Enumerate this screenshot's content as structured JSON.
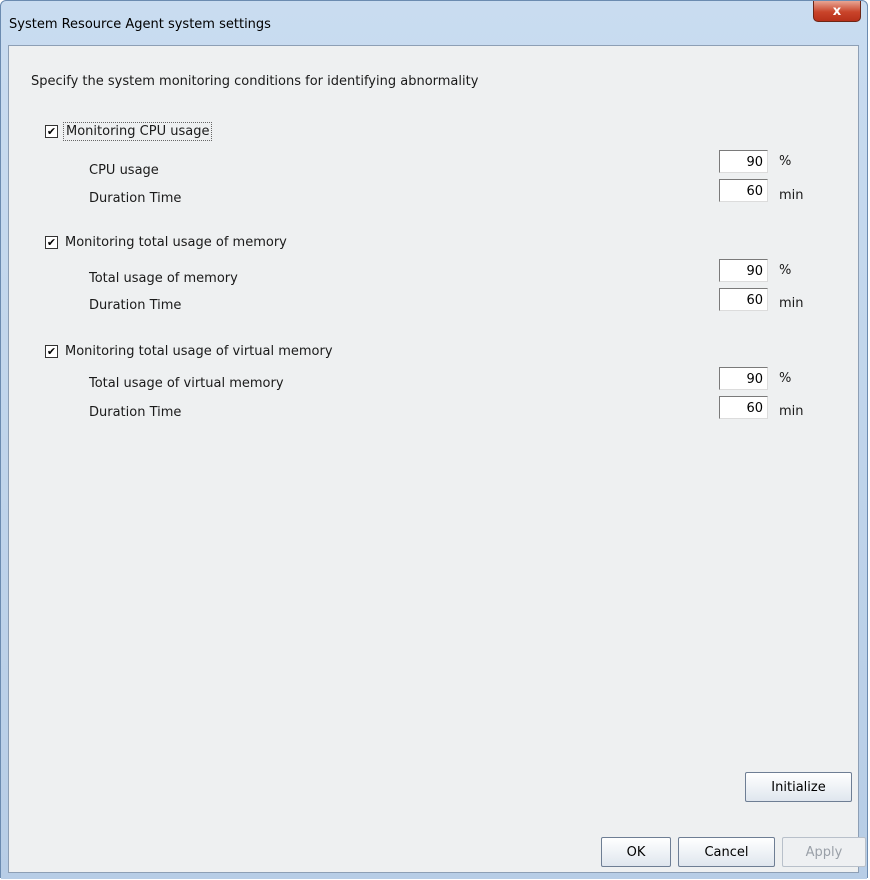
{
  "window": {
    "title": "System Resource Agent system settings",
    "close_label": "x"
  },
  "description": "Specify the system monitoring conditions for identifying abnormality",
  "cpu": {
    "checkbox_label": "Monitoring CPU usage",
    "checked": "✔",
    "usage_label": "CPU usage",
    "usage_value": "90",
    "usage_unit": "%",
    "duration_label": "Duration Time",
    "duration_value": "60",
    "duration_unit": "min"
  },
  "memory": {
    "checkbox_label": "Monitoring total usage of memory",
    "checked": "✔",
    "usage_label": "Total usage of memory",
    "usage_value": "90",
    "usage_unit": "%",
    "duration_label": "Duration Time",
    "duration_value": "60",
    "duration_unit": "min"
  },
  "virtual_memory": {
    "checkbox_label": "Monitoring total usage of virtual memory",
    "checked": "✔",
    "usage_label": "Total usage of virtual memory",
    "usage_value": "90",
    "usage_unit": "%",
    "duration_label": "Duration Time",
    "duration_value": "60",
    "duration_unit": "min"
  },
  "buttons": {
    "initialize": "Initialize",
    "ok": "OK",
    "cancel": "Cancel",
    "apply": "Apply"
  }
}
